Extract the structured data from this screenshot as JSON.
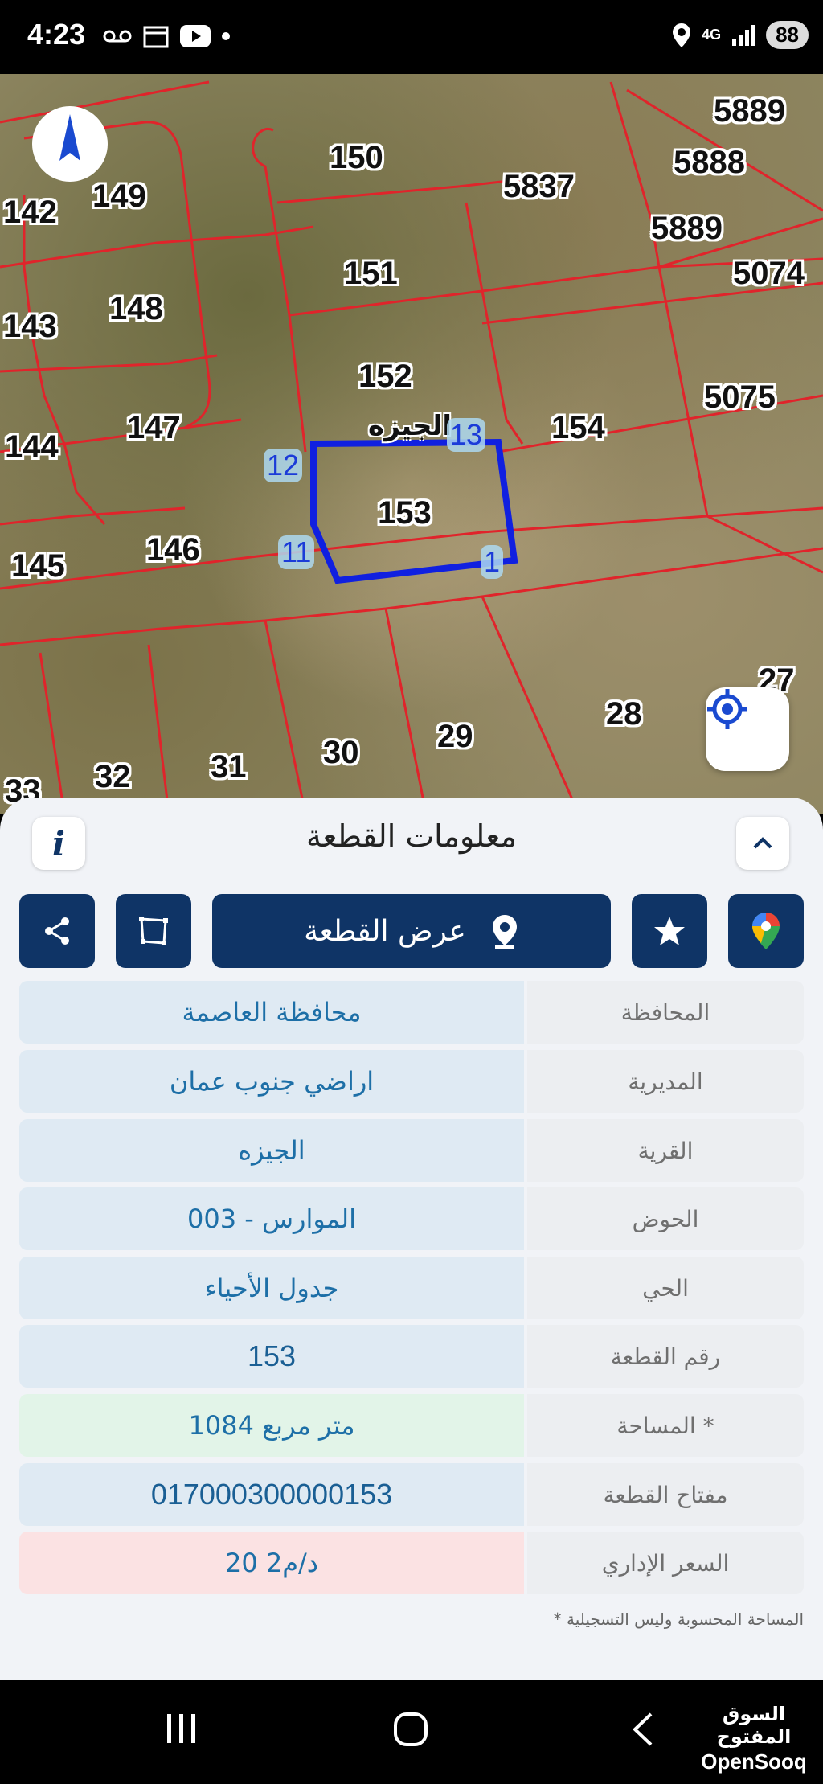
{
  "status_bar": {
    "time": "4:23",
    "network": "4G",
    "battery": "88"
  },
  "map": {
    "plots": [
      "142",
      "149",
      "150",
      "5837",
      "5888",
      "5889",
      "5074",
      "143",
      "148",
      "151",
      "152",
      "154",
      "5075",
      "144",
      "147",
      "153",
      "145",
      "146",
      "28",
      "27",
      "29",
      "30",
      "31",
      "32",
      "33",
      "5889"
    ],
    "village_label": "الجيزه",
    "vertices": [
      "13",
      "12",
      "11",
      "1"
    ]
  },
  "panel": {
    "title": "معلومات القطعة",
    "show_plot_label": "عرض القطعة",
    "rows": [
      {
        "label": "المحافظة",
        "value": "محافظة العاصمة"
      },
      {
        "label": "المديرية",
        "value": "اراضي جنوب عمان"
      },
      {
        "label": "القرية",
        "value": "الجيزه"
      },
      {
        "label": "الحوض",
        "value": "الموارس - 003"
      },
      {
        "label": "الحي",
        "value": "جدول الأحياء"
      },
      {
        "label": "رقم القطعة",
        "value": "153"
      },
      {
        "label": "المساحة *",
        "value": "1084   متر مربع"
      },
      {
        "label": "مفتاح القطعة",
        "value": "017000300000153"
      },
      {
        "label": "السعر الإداري",
        "value": "20 د/م2"
      }
    ],
    "footnote": "* المساحة المحسوبة وليس التسجيلية"
  },
  "brand": {
    "arabic": "السوق المفتوح",
    "english": "OpenSooq"
  },
  "colors": {
    "primary": "#0f3466",
    "parcel_line": "#e0242b",
    "selected_parcel": "#1020e0"
  }
}
